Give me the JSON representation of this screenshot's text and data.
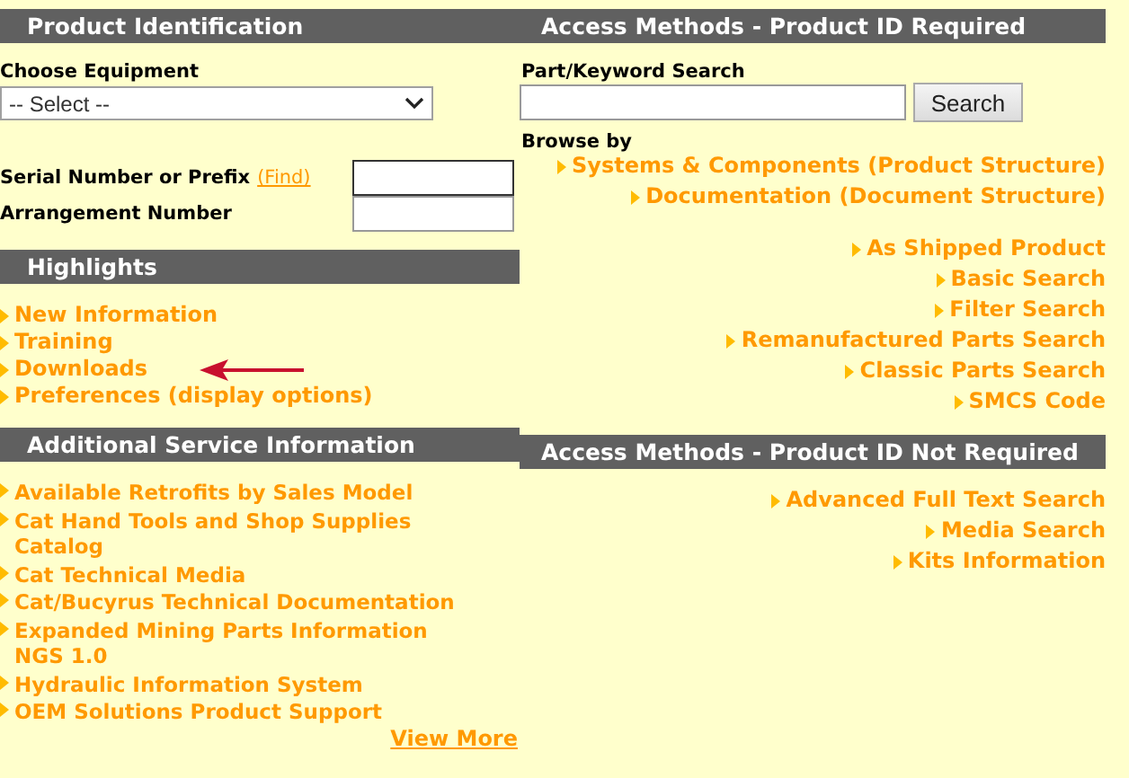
{
  "product_identification": {
    "title": "Product Identification",
    "equipment_label": "Choose Equipment",
    "equipment_select": {
      "value": "-- Select --"
    },
    "serial_label": "Serial Number or Prefix",
    "find_link": "(Find)",
    "arrangement_label": "Arrangement Number"
  },
  "highlights": {
    "title": "Highlights",
    "links": [
      {
        "label": "New Information",
        "pointed_at": false
      },
      {
        "label": "Training",
        "pointed_at": false
      },
      {
        "label": "Downloads",
        "pointed_at": true
      },
      {
        "label": "Preferences (display options)",
        "pointed_at": false
      }
    ]
  },
  "additional_service": {
    "title": "Additional Service Information",
    "links": [
      "Available Retrofits by Sales Model",
      "Cat Hand Tools and Shop Supplies Catalog",
      "Cat Technical Media",
      "Cat/Bucyrus Technical Documentation",
      "Expanded Mining Parts Information NGS 1.0",
      "Hydraulic Information System",
      "OEM Solutions Product Support"
    ],
    "view_more": "View More"
  },
  "access_required": {
    "title": "Access Methods - Product ID Required",
    "search_label": "Part/Keyword Search",
    "search_button": "Search",
    "browse_label": "Browse by",
    "browse_links": [
      "Systems & Components (Product Structure)",
      "Documentation (Document Structure)"
    ],
    "search_links": [
      "As Shipped Product",
      "Basic Search",
      "Filter Search",
      "Remanufactured Parts Search",
      "Classic Parts Search",
      "SMCS Code"
    ]
  },
  "access_not_required": {
    "title": "Access Methods - Product ID Not Required",
    "links": [
      "Advanced Full Text Search",
      "Media Search",
      "Kits Information"
    ]
  }
}
